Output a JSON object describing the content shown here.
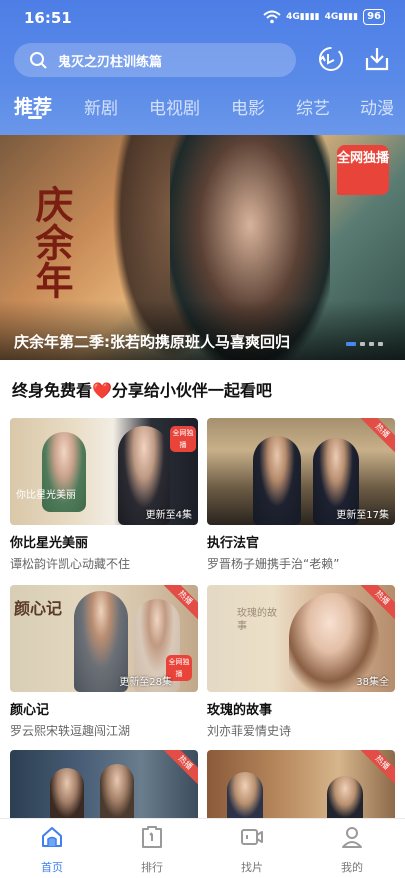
{
  "status": {
    "time": "16:51",
    "battery": "96",
    "signal1": "4G",
    "signal2": "4G"
  },
  "search": {
    "placeholder": "鬼灭之刃柱训练篇"
  },
  "tabs": [
    {
      "label": "推荐",
      "active": true
    },
    {
      "label": "新剧"
    },
    {
      "label": "电视剧"
    },
    {
      "label": "电影"
    },
    {
      "label": "综艺"
    },
    {
      "label": "动漫"
    }
  ],
  "banner": {
    "title_art": "庆余年",
    "badge": "全网独播",
    "caption": "庆余年第二季:张若昀携原班人马喜爽回归"
  },
  "section": {
    "title": "终身免费看❤️分享给小伙伴一起看吧"
  },
  "cards": [
    {
      "title": "你比星光美丽",
      "subtitle": "谭松韵许凯心动藏不住",
      "episodes": "更新至4集",
      "hot": "",
      "exclusive": "全网独播",
      "art": "你比星光美丽"
    },
    {
      "title": "执行法官",
      "subtitle": "罗晋杨子姗携手治“老赖”",
      "episodes": "更新至17集",
      "hot": "热播"
    },
    {
      "title": "颜心记",
      "subtitle": "罗云熙宋轶逗趣闯江湖",
      "episodes": "更新至28集",
      "hot": "热播",
      "exclusive": "全网独播",
      "art": "颜心记"
    },
    {
      "title": "玫瑰的故事",
      "subtitle": "刘亦菲爱情史诗",
      "episodes": "38集全",
      "hot": "热播",
      "art": "玫瑰的故事"
    },
    {
      "title": "",
      "subtitle": "",
      "episodes": "",
      "hot": "热播"
    },
    {
      "title": "",
      "subtitle": "",
      "episodes": "",
      "hot": "热播"
    }
  ],
  "nav": [
    {
      "label": "首页",
      "icon": "home-icon",
      "active": true
    },
    {
      "label": "排行",
      "icon": "ranking-icon"
    },
    {
      "label": "找片",
      "icon": "video-camera-icon"
    },
    {
      "label": "我的",
      "icon": "user-icon"
    }
  ],
  "colors": {
    "accent": "#3f7ff0",
    "header": "#5a8ae8",
    "hot": "#e24d46"
  }
}
